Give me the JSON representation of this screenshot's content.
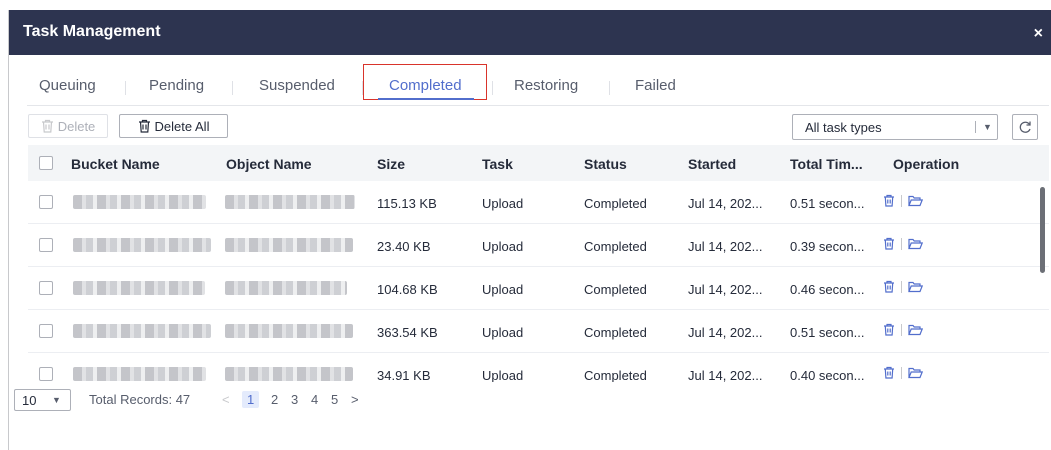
{
  "dialog": {
    "title": "Task Management",
    "close_label": "×"
  },
  "tabs": [
    {
      "label": "Queuing"
    },
    {
      "label": "Pending"
    },
    {
      "label": "Suspended"
    },
    {
      "label": "Completed",
      "active": true
    },
    {
      "label": "Restoring"
    },
    {
      "label": "Failed"
    }
  ],
  "toolbar": {
    "delete_label": "Delete",
    "delete_all_label": "Delete All",
    "task_type_value": "All task types",
    "refresh_icon": "refresh-icon"
  },
  "table": {
    "columns": [
      "Bucket Name",
      "Object Name",
      "Size",
      "Task",
      "Status",
      "Started",
      "Total Tim...",
      "Operation"
    ],
    "rows": [
      {
        "size": "115.13 KB",
        "task": "Upload",
        "status": "Completed",
        "started": "Jul 14, 202...",
        "total_time": "0.51 secon..."
      },
      {
        "size": "23.40 KB",
        "task": "Upload",
        "status": "Completed",
        "started": "Jul 14, 202...",
        "total_time": "0.39 secon..."
      },
      {
        "size": "104.68 KB",
        "task": "Upload",
        "status": "Completed",
        "started": "Jul 14, 202...",
        "total_time": "0.46 secon..."
      },
      {
        "size": "363.54 KB",
        "task": "Upload",
        "status": "Completed",
        "started": "Jul 14, 202...",
        "total_time": "0.51 secon..."
      },
      {
        "size": "34.91 KB",
        "task": "Upload",
        "status": "Completed",
        "started": "Jul 14, 202...",
        "total_time": "0.40 secon..."
      }
    ]
  },
  "pagination": {
    "page_size": "10",
    "total_records": "Total Records: 47",
    "prev": "<",
    "pages": [
      "1",
      "2",
      "3",
      "4",
      "5"
    ],
    "next": ">"
  },
  "colors": {
    "title_bar": "#2d3450",
    "accent": "#526ecc",
    "highlight_border": "#d9342b"
  }
}
